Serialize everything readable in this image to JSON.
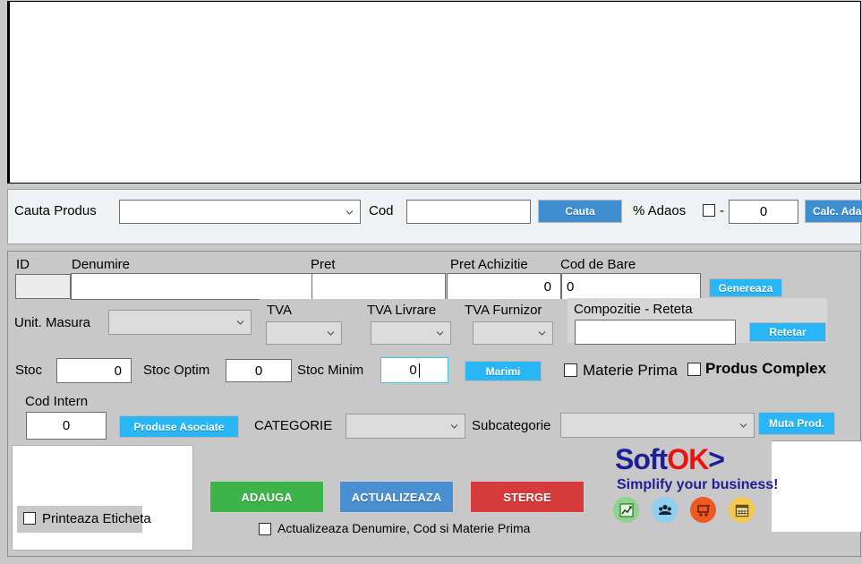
{
  "search_bar": {
    "cauta_produs_label": "Cauta Produs",
    "produs_combo_value": "",
    "cod_label": "Cod",
    "cod_value": "",
    "cauta_button": "Cauta",
    "adaos_label": "% Adaos",
    "adaos_dash": "-",
    "adaos_value": "0",
    "calc_adaos_button": "Calc. Adaos"
  },
  "form": {
    "id_label": "ID",
    "id_value": "",
    "denumire_label": "Denumire",
    "denumire_value": "",
    "pret_label": "Pret",
    "pret_value": "",
    "pret_achizitie_label": "Pret Achizitie",
    "pret_achizitie_value": "0",
    "cod_de_bare_label": "Cod de Bare",
    "cod_de_bare_value": "0",
    "genereaza_button": "Genereaza",
    "unit_masura_label": "Unit. Masura",
    "unit_masura_value": "",
    "tva_label": "TVA",
    "tva_value": "",
    "tva_livrare_label": "TVA Livrare",
    "tva_livrare_value": "",
    "tva_furnizor_label": "TVA Furnizor",
    "tva_furnizor_value": "",
    "compozitie_label": "Compozitie - Reteta",
    "compozitie_value": "",
    "retetar_button": "Retetar",
    "stoc_label": "Stoc",
    "stoc_value": "0",
    "stoc_optim_label": "Stoc Optim",
    "stoc_optim_value": "0",
    "stoc_minim_label": "Stoc Minim",
    "stoc_minim_value": "0",
    "marimi_button": "Marimi",
    "materie_prima_label": "Materie Prima",
    "produs_complex_label": "Produs Complex",
    "cod_intern_label": "Cod Intern",
    "cod_intern_value": "0",
    "produse_asociate_button": "Produse Asociate",
    "categorie_label": "CATEGORIE",
    "categorie_value": "",
    "subcategorie_label": "Subcategorie",
    "subcategorie_value": "",
    "muta_prod_button": "Muta Prod.",
    "printeaza_eticheta_label": "Printeaza Eticheta",
    "adauga_button": "ADAUGA",
    "actualizeaza_button": "ACTUALIZEAZA",
    "sterge_button": "STERGE",
    "actualizeaza_check_label": "Actualizeaza Denumire, Cod si Materie Prima"
  },
  "logo": {
    "word_soft": "Soft",
    "word_ok": "OK",
    "word_gt": ">",
    "tagline": "Simplify your business!"
  },
  "colors": {
    "accent_blue": "#3e8ed0",
    "cyan_button": "#29b6f6",
    "green_button": "#3cb44a",
    "blue_button": "#4a8fd0",
    "red_button": "#d63b3b",
    "logo_navy": "#1e1e96",
    "logo_red": "#ee1111",
    "panel_gray": "#c8c8c8",
    "focus_cyan": "#41c5d6"
  }
}
